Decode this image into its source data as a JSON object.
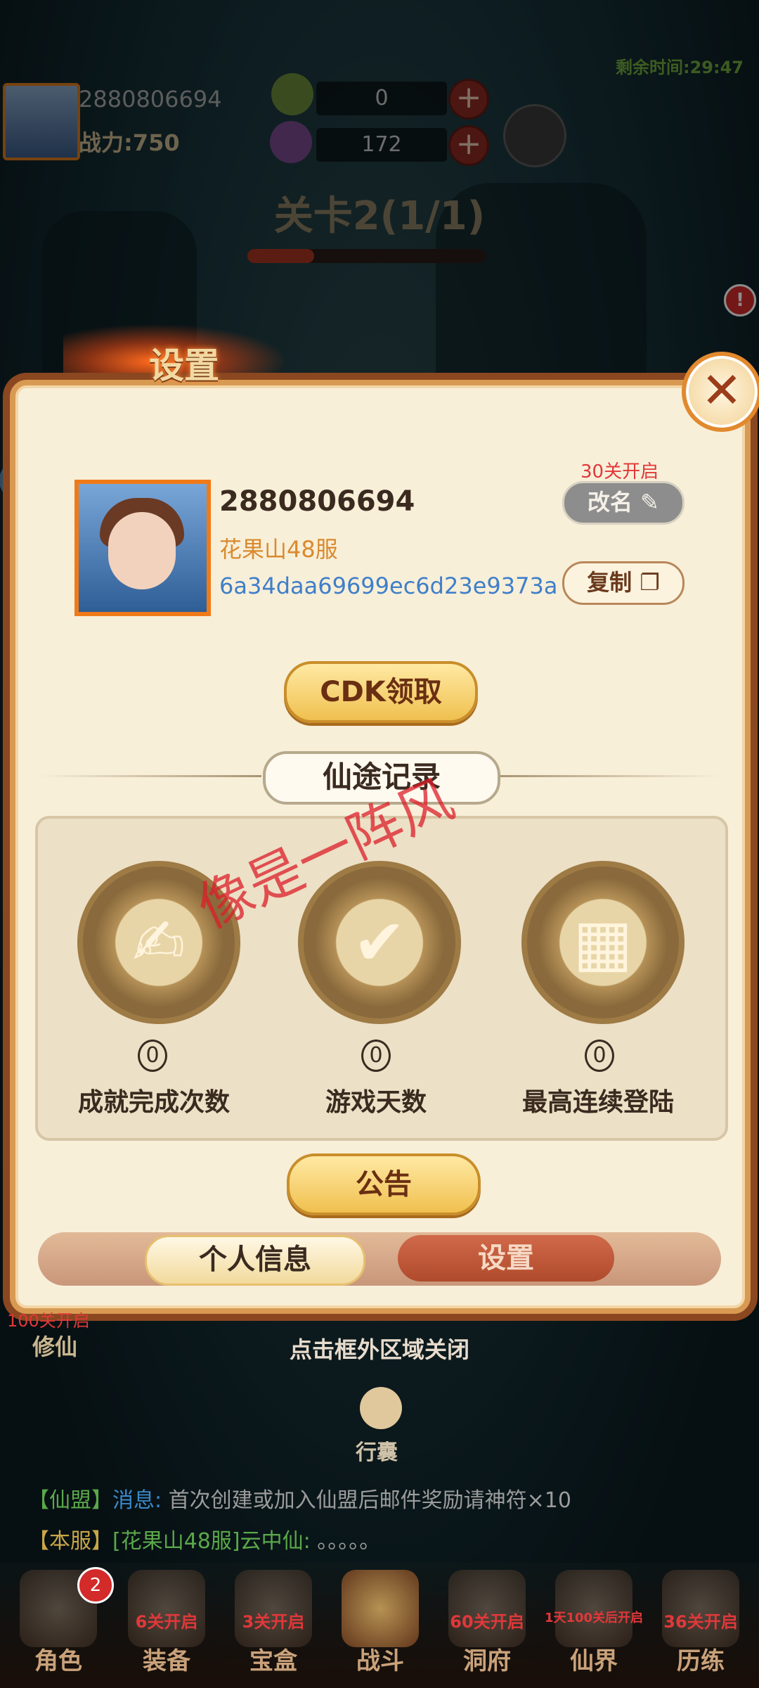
{
  "hud": {
    "player_id": "2880806694",
    "power": "战力:750",
    "currency1": "0",
    "currency2": "172",
    "time_left": "剩余时间:29:47",
    "stage": "关卡2(1/1)",
    "stage_progress": 0.28
  },
  "settings": {
    "title": "设置",
    "close": "✕",
    "profile": {
      "uid": "2880806694",
      "server": "花果山48服",
      "hash": "6a34daa69699ec6d23e9373a",
      "unlock_note": "30关开启",
      "rename": "改名",
      "copy": "复制"
    },
    "cdk": "CDK领取",
    "record_title": "仙途记录",
    "stats": [
      {
        "value": "0",
        "label": "成就完成次数",
        "icon": "scroll-brush-icon"
      },
      {
        "value": "0",
        "label": "游戏天数",
        "icon": "calendar-check-icon"
      },
      {
        "value": "0",
        "label": "最高连续登陆",
        "icon": "calendar-brush-icon"
      }
    ],
    "notice": "公告",
    "tabs": {
      "personal": "个人信息",
      "settings": "设置"
    },
    "watermark": "像是一阵风"
  },
  "below": {
    "close_hint": "点击框外区域关闭",
    "xiuxian_lock": "100关开启",
    "xiuxian": "修仙",
    "bag": "行囊",
    "chat1": {
      "tag": "【仙盟】",
      "prefix": "消息:",
      "text": " 首次创建或加入仙盟后邮件奖励请神符×10"
    },
    "chat2": {
      "tag": "【本服】",
      "server": "[花果山48服]",
      "name": "云中仙:",
      "text": " 。。。。。"
    }
  },
  "nav": [
    {
      "label": "角色",
      "lock": "",
      "badge": "2"
    },
    {
      "label": "装备",
      "lock": "6关开启"
    },
    {
      "label": "宝盒",
      "lock": "3关开启"
    },
    {
      "label": "战斗",
      "lock": ""
    },
    {
      "label": "洞府",
      "lock": "60关开启"
    },
    {
      "label": "仙界",
      "lock": "1天100关后开启"
    },
    {
      "label": "历练",
      "lock": "36关开启"
    }
  ]
}
